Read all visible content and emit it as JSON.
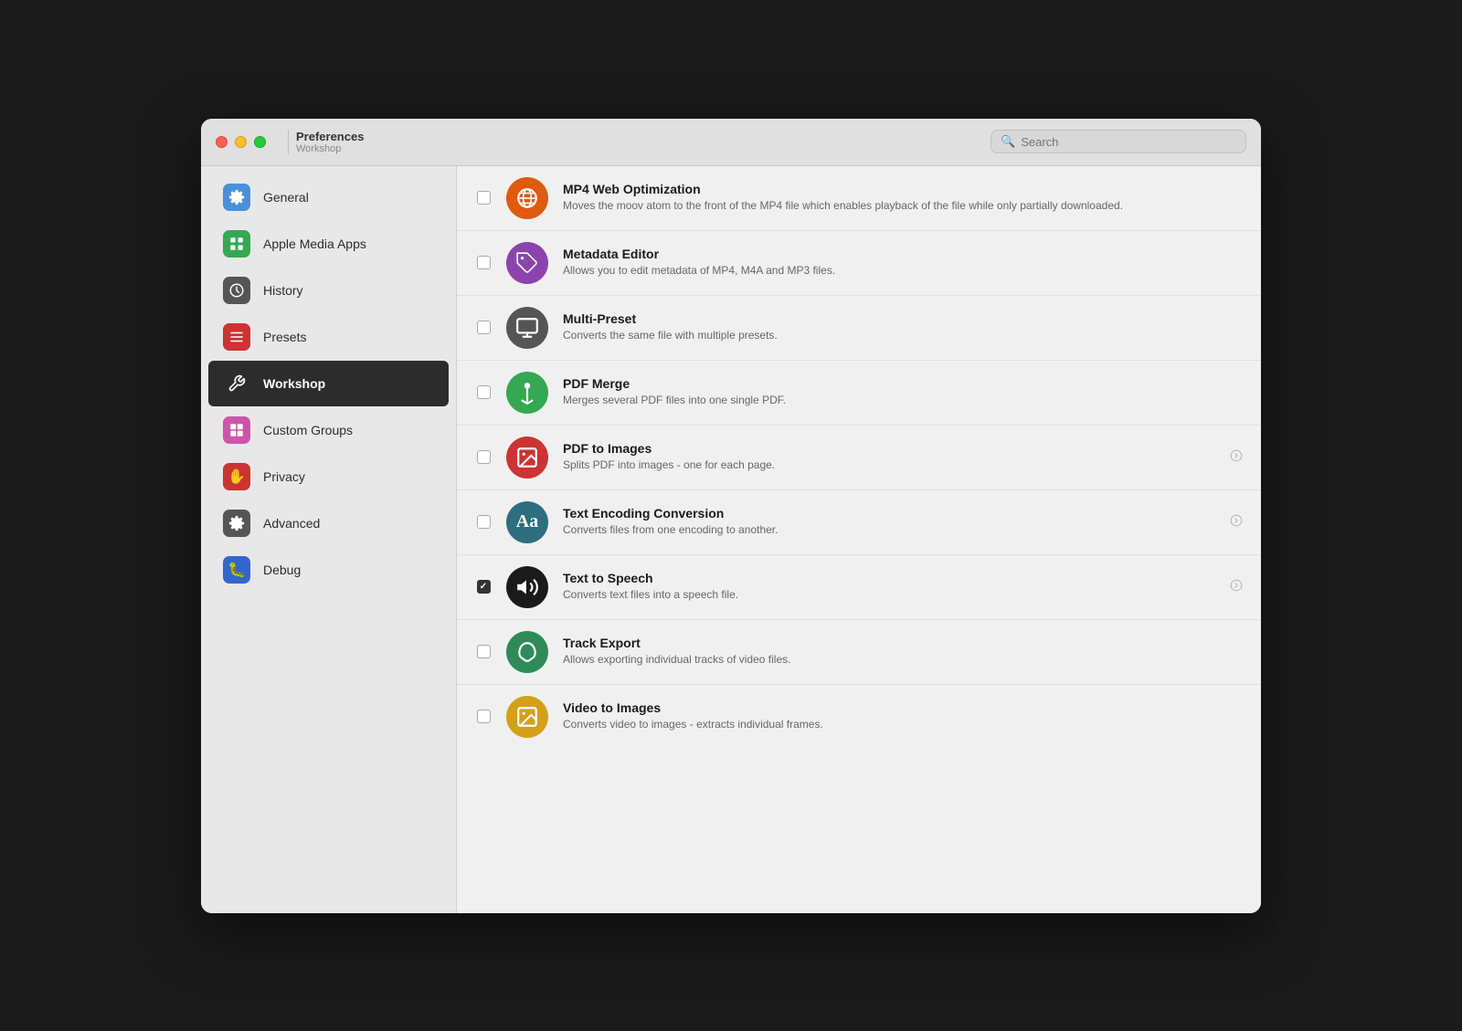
{
  "titlebar": {
    "title": "Preferences",
    "subtitle": "Workshop",
    "search_placeholder": "Search"
  },
  "sidebar": {
    "items": [
      {
        "id": "general",
        "label": "General",
        "icon": "⚙️",
        "bg": "#4a90d9",
        "active": false
      },
      {
        "id": "apple-media-apps",
        "label": "Apple Media Apps",
        "icon": "▶",
        "bg": "#34a853",
        "active": false
      },
      {
        "id": "history",
        "label": "History",
        "icon": "🕐",
        "bg": "#555",
        "active": false
      },
      {
        "id": "presets",
        "label": "Presets",
        "icon": "≡",
        "bg": "#cc3333",
        "active": false
      },
      {
        "id": "workshop",
        "label": "Workshop",
        "icon": "✂",
        "bg": "#2c2c2c",
        "active": true
      },
      {
        "id": "custom-groups",
        "label": "Custom Groups",
        "icon": "⊞",
        "bg": "#cc55aa",
        "active": false
      },
      {
        "id": "privacy",
        "label": "Privacy",
        "icon": "🖐",
        "bg": "#cc3333",
        "active": false
      },
      {
        "id": "advanced",
        "label": "Advanced",
        "icon": "⚙",
        "bg": "#555",
        "active": false
      },
      {
        "id": "debug",
        "label": "Debug",
        "icon": "🐛",
        "bg": "#3366cc",
        "active": false
      }
    ]
  },
  "workshop_items": [
    {
      "id": "mp4-web-optimization",
      "title": "MP4 Web Optimization",
      "description": "Moves the moov atom to the front of the MP4 file which enables playback of the file while only partially downloaded.",
      "checked": false,
      "has_arrow": false,
      "icon_bg": "#e05a10",
      "icon_symbol": "🌐"
    },
    {
      "id": "metadata-editor",
      "title": "Metadata Editor",
      "description": "Allows you to edit metadata of MP4, M4A and MP3 files.",
      "checked": false,
      "has_arrow": false,
      "icon_bg": "#8b44ac",
      "icon_symbol": "🏷"
    },
    {
      "id": "multi-preset",
      "title": "Multi-Preset",
      "description": "Converts the same file with multiple presets.",
      "checked": false,
      "has_arrow": false,
      "icon_bg": "#555",
      "icon_symbol": "▣"
    },
    {
      "id": "pdf-merge",
      "title": "PDF Merge",
      "description": "Merges several PDF files into one single PDF.",
      "checked": false,
      "has_arrow": false,
      "icon_bg": "#34a853",
      "icon_symbol": "↑"
    },
    {
      "id": "pdf-to-images",
      "title": "PDF to Images",
      "description": "Splits PDF into images - one for each page.",
      "checked": false,
      "has_arrow": true,
      "icon_bg": "#cc3333",
      "icon_symbol": "🖼"
    },
    {
      "id": "text-encoding-conversion",
      "title": "Text Encoding Conversion",
      "description": "Converts files from one encoding to another.",
      "checked": false,
      "has_arrow": true,
      "icon_bg": "#2e6e7e",
      "icon_symbol": "Aa"
    },
    {
      "id": "text-to-speech",
      "title": "Text to Speech",
      "description": "Converts text files into a speech file.",
      "checked": true,
      "has_arrow": true,
      "icon_bg": "#1a1a1a",
      "icon_symbol": "🔊"
    },
    {
      "id": "track-export",
      "title": "Track Export",
      "description": "Allows exporting individual tracks of video files.",
      "checked": false,
      "has_arrow": false,
      "icon_bg": "#2e8b57",
      "icon_symbol": "Y"
    },
    {
      "id": "video-to-images",
      "title": "Video to Images",
      "description": "Converts video to images - extracts individual frames.",
      "checked": false,
      "has_arrow": false,
      "icon_bg": "#d4a017",
      "icon_symbol": "🖼"
    }
  ]
}
